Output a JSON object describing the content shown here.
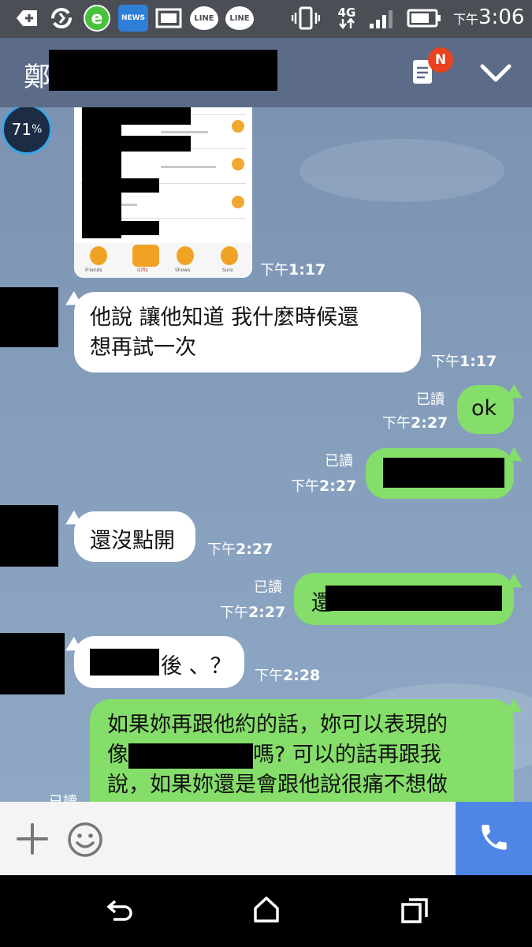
{
  "status_bar": {
    "icons": [
      "plus-circle-icon",
      "sync-icon",
      "e-browser-icon",
      "news-icon",
      "gallery-icon",
      "line-icon",
      "line-icon",
      "vibrate-icon",
      "signal-4g-icon",
      "signal-bars-icon",
      "battery-icon"
    ],
    "news_label": "NEWS",
    "line_label": "LINE",
    "network_label": "4G",
    "time_prefix": "下午",
    "time": "3:06"
  },
  "header": {
    "contact_name_visible": "鄭",
    "notes_badge": "N"
  },
  "progress_badge": {
    "value": "71",
    "unit": "%"
  },
  "messages": [
    {
      "side": "left",
      "type": "image",
      "time_prefix": "下午",
      "time": "1:17",
      "sticker_captions": [
        "Friends",
        "Gifts",
        "Shows",
        "Sure"
      ]
    },
    {
      "side": "left",
      "type": "text",
      "text": "他說 讓他知道 我什麼時候還想再試一次",
      "line1": "他說 讓他知道 我什麼時候還",
      "line2": "想再試一次",
      "time_prefix": "下午",
      "time": "1:17"
    },
    {
      "side": "right",
      "type": "text",
      "text": "ok",
      "read": "已讀",
      "time_prefix": "下午",
      "time": "2:27"
    },
    {
      "side": "right",
      "type": "text",
      "text": "",
      "read": "已讀",
      "time_prefix": "下午",
      "time": "2:27"
    },
    {
      "side": "left",
      "type": "text",
      "text": "還沒點開",
      "time_prefix": "下午",
      "time": "2:27"
    },
    {
      "side": "right",
      "type": "text",
      "text": "還",
      "read": "已讀",
      "time_prefix": "下午",
      "time": "2:27"
    },
    {
      "side": "left",
      "type": "text",
      "text": "後 、？",
      "time_prefix": "下午",
      "time": "2:28"
    },
    {
      "side": "right",
      "type": "text",
      "line1": "如果妳再跟他約的話，妳可以表現的",
      "line2_a": "像",
      "line2_b": "嗎? 可以的話再跟我",
      "line3": "說，如果妳還是會跟他說很痛不想做",
      "read": "已讀"
    }
  ],
  "input_bar": {
    "icons": [
      "add-icon",
      "emoji-icon",
      "phone-icon"
    ]
  },
  "nav_bar": {
    "icons": [
      "back-icon",
      "home-icon",
      "recents-icon"
    ]
  },
  "colors": {
    "header": "#5c6c88",
    "status_bar": "#4b4f55",
    "chat_background": "#7f96b4",
    "bubble_sent": "#85de6a",
    "bubble_received": "#ffffff",
    "call_button": "#4f86e6",
    "badge": "#e8421e"
  }
}
